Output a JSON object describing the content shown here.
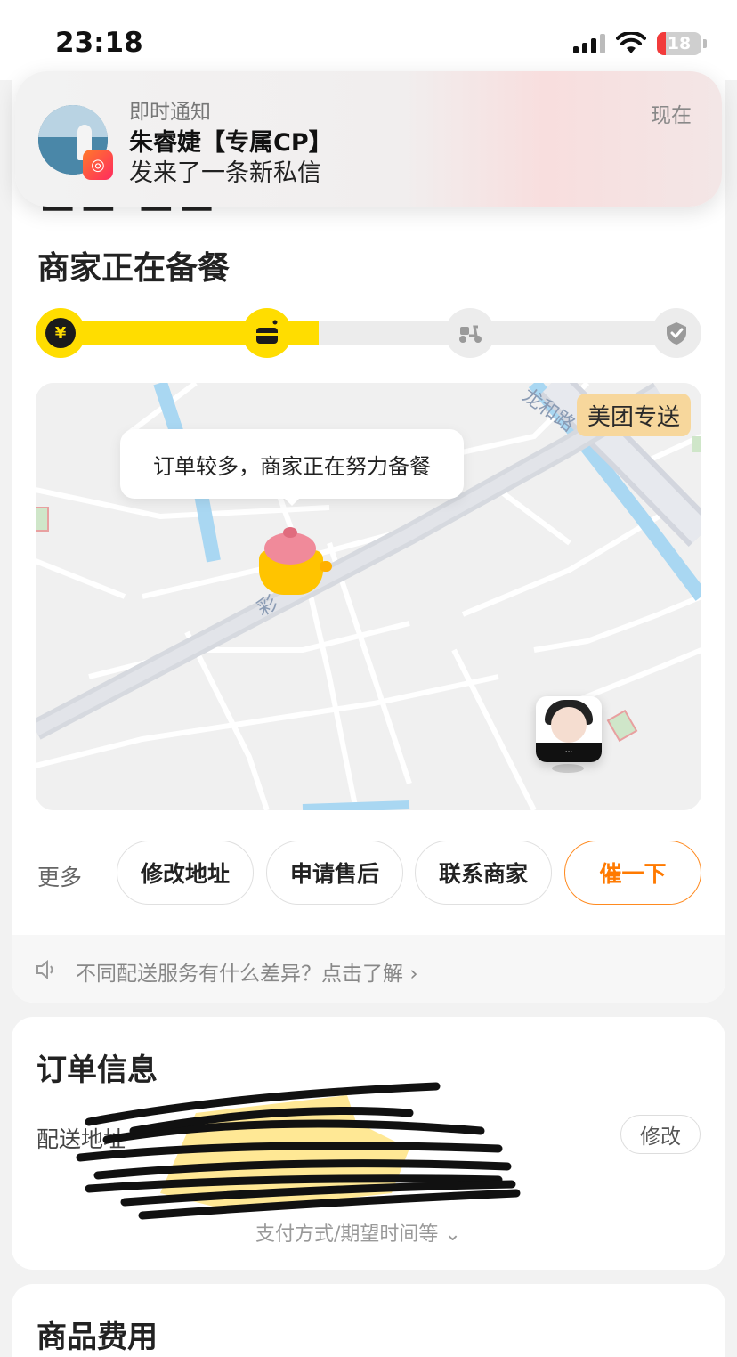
{
  "status_bar": {
    "time": "23:18",
    "battery": "18"
  },
  "notification": {
    "label": "即时通知",
    "title": "朱睿婕【专属CP】",
    "body": "发来了一条新私信",
    "time": "现在",
    "app_icon": "kuaishou-app-icon"
  },
  "order_status": {
    "title": "商家正在备餐",
    "progress_steps": [
      {
        "icon": "yuan-icon",
        "state": "done"
      },
      {
        "icon": "food-box-icon",
        "state": "current"
      },
      {
        "icon": "scooter-icon",
        "state": "pending"
      },
      {
        "icon": "check-shield-icon",
        "state": "pending"
      }
    ],
    "progress_fraction": 0.42
  },
  "map": {
    "badge": "美团专送",
    "bubble_text": "订单较多，商家正在努力备餐",
    "road_label": "龙和路"
  },
  "actions": {
    "more": "更多",
    "buttons": [
      "修改地址",
      "申请售后",
      "联系商家",
      "催一下"
    ]
  },
  "tip": {
    "text": "不同配送服务有什么差异？点击了解"
  },
  "order_info": {
    "title": "订单信息",
    "address_label": "配送地址",
    "edit_label": "修改",
    "expand_label": "支付方式/期望时间等"
  },
  "goods": {
    "title": "商品费用"
  },
  "colors": {
    "accent_yellow": "#ffdd00",
    "urge_orange": "#ff7a00",
    "badge_bg": "#f7d79c"
  }
}
